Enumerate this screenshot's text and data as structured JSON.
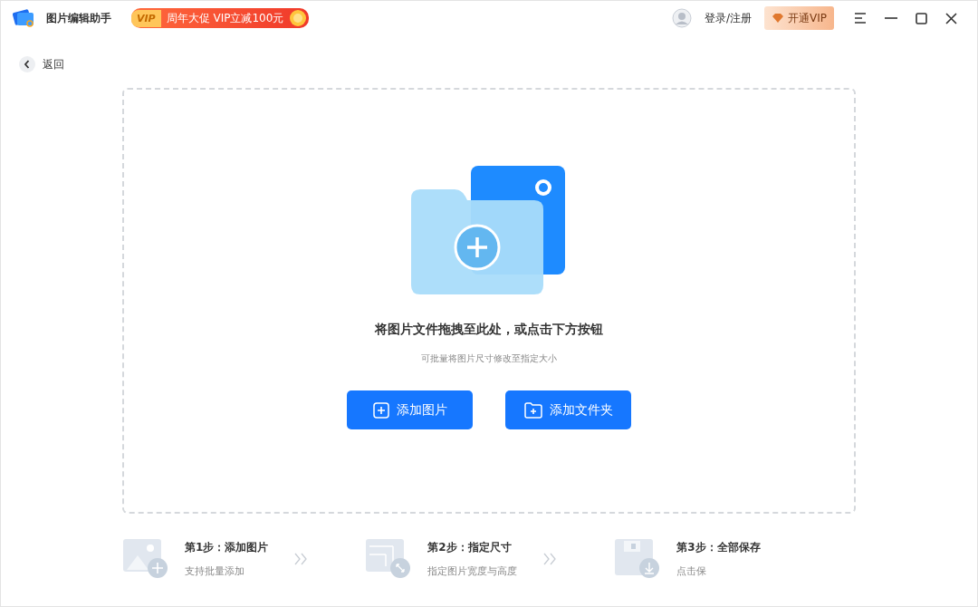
{
  "app": {
    "title": "图片编辑助手",
    "promo_badge": "VIP",
    "promo": "周年大促 VIP立减100元"
  },
  "account": {
    "login": "登录/注册",
    "vip_button": "开通VIP"
  },
  "back": "返回",
  "dropzone": {
    "title": "将图片文件拖拽至此处，或点击下方按钮",
    "hint": "可批量将图片尺寸修改至指定大小",
    "buttons": [
      {
        "kind": "image",
        "label": "添加图片"
      },
      {
        "kind": "folder",
        "label": "添加文件夹"
      }
    ]
  },
  "steps": [
    {
      "kind": "add",
      "title": "第1步：添加图片",
      "desc": "支持批量添加"
    },
    {
      "kind": "resize",
      "title": "第2步：指定尺寸",
      "desc": "指定图片宽度与高度"
    },
    {
      "kind": "save",
      "title": "第3步：全部保存",
      "desc": "点击保"
    }
  ]
}
